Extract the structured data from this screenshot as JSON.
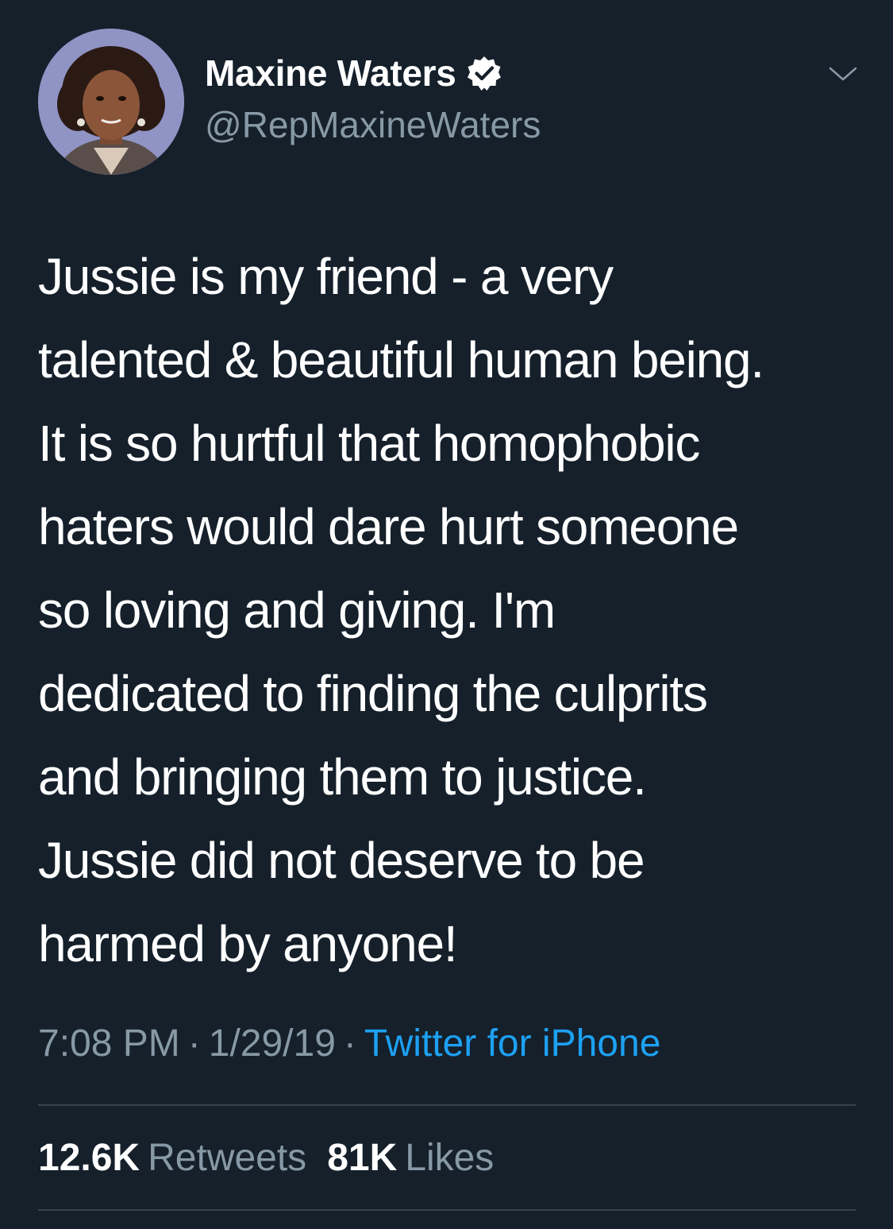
{
  "tweet": {
    "author": {
      "display_name": "Maxine Waters",
      "handle": "@RepMaxineWaters",
      "verified_icon": "verified-badge-icon",
      "avatar_background": "#8f94c4"
    },
    "menu_icon": "chevron-down-icon",
    "text_lines": [
      "Jussie is my friend - a very",
      "talented & beautiful human being.",
      "It is so hurtful that homophobic",
      "haters would dare hurt someone",
      "so loving and giving. I'm",
      "dedicated to finding the culprits",
      "and bringing them to justice.",
      "Jussie did not deserve to be",
      "harmed by anyone!"
    ],
    "time": "7:08 PM",
    "separator": "·",
    "date": "1/29/19",
    "source": "Twitter for iPhone",
    "retweets_count": "12.6K",
    "retweets_label": "Retweets",
    "likes_count": "81K",
    "likes_label": "Likes"
  },
  "colors": {
    "background": "#15202b",
    "text_primary": "#ffffff",
    "text_secondary": "#8899a6",
    "link": "#1da1f2",
    "divider": "#38444d"
  }
}
